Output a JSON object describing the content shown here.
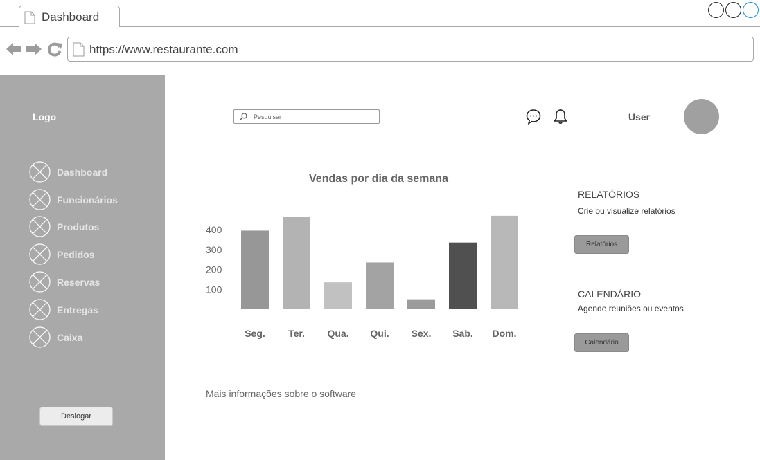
{
  "browser": {
    "tab_title": "Dashboard",
    "url": "https://www.restaurante.com"
  },
  "sidebar": {
    "logo": "Logo",
    "items": [
      {
        "label": "Dashboard"
      },
      {
        "label": "Funcionários"
      },
      {
        "label": "Produtos"
      },
      {
        "label": "Pedidos"
      },
      {
        "label": "Reservas"
      },
      {
        "label": "Entregas"
      },
      {
        "label": "Caixa"
      }
    ],
    "logout_label": "Deslogar"
  },
  "header": {
    "search_placeholder": "Pesquisar",
    "user_label": "User",
    "icons": [
      "chat-icon",
      "bell-icon"
    ]
  },
  "chart_data": {
    "type": "bar",
    "title": "Vendas por dia da semana",
    "xlabel": "",
    "ylabel": "",
    "categories": [
      "Seg.",
      "Ter.",
      "Qua.",
      "Qui.",
      "Sex.",
      "Sab.",
      "Dom."
    ],
    "values": [
      395,
      465,
      135,
      235,
      50,
      335,
      470
    ],
    "yticks": [
      100,
      200,
      300,
      400
    ],
    "ylim": [
      0,
      480
    ],
    "grid": false,
    "colors": [
      "#979797",
      "#b3b3b3",
      "#c1c1c1",
      "#a3a3a3",
      "#9b9b9b",
      "#505050",
      "#b8b8b8"
    ]
  },
  "panels": {
    "reports": {
      "heading": "RELATÓRIOS",
      "description": "Crie ou visualize relatórios",
      "button": "Relatórios"
    },
    "calendar": {
      "heading": "CALENDÁRIO",
      "description": "Agende reuniões ou eventos",
      "button": "Calendário"
    }
  },
  "footer": {
    "more_info": "Mais informações sobre o software"
  }
}
